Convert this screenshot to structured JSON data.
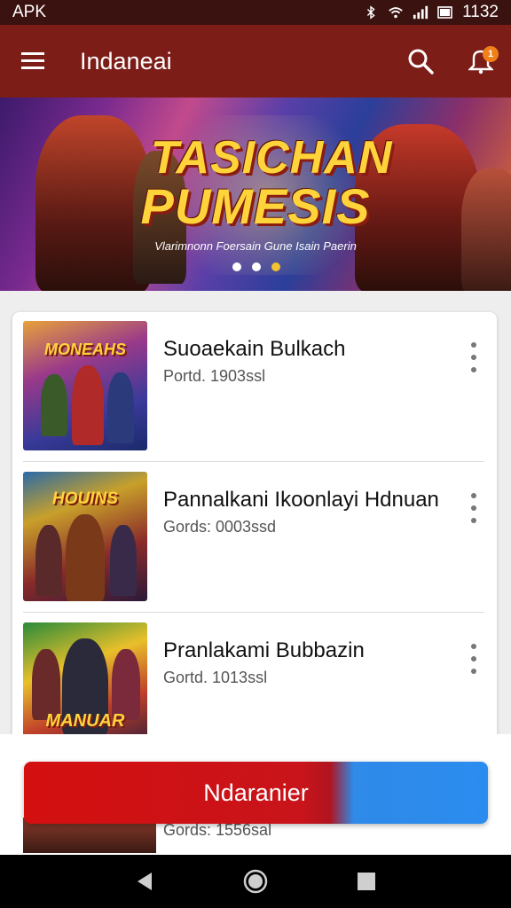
{
  "status_bar": {
    "left_text": "APK",
    "time": "1132",
    "icons": [
      "bluetooth-icon",
      "wifi-icon",
      "signal-icon",
      "battery-icon"
    ]
  },
  "app_bar": {
    "title": "Indaneai",
    "notification_count": "1",
    "icons": [
      "menu-icon",
      "search-icon",
      "notification-icon"
    ]
  },
  "banner": {
    "title_line1": "TASICHAN",
    "title_line2": "PUMESIS",
    "tagline": "Vlarimnonn Foersain Gune Isain Paerin",
    "page_count": 3,
    "active_index": 2
  },
  "list": {
    "items": [
      {
        "name": "Suoaekain Bulkach",
        "subtitle": "Portd. 1903ssl",
        "thumb_title": "MONEAHS"
      },
      {
        "name": "Pannalkani Ikoonlayi Hdnuan",
        "subtitle": "Gords: 0003ssd",
        "thumb_title": "HOUINS"
      },
      {
        "name": "Pranlakami Bubbazin",
        "subtitle": "Gortd. 1013ssl",
        "thumb_title": "MANUAR"
      }
    ]
  },
  "bottom_sheet": {
    "cta_label": "Ndaranier",
    "peek_subtitle": "Gords: 1556sal"
  },
  "nav_bar": {
    "icons": [
      "back-icon",
      "home-icon",
      "recents-icon"
    ]
  },
  "colors": {
    "app_bar": "#7d1d18",
    "status_bar": "#3a1210",
    "cta_red": "#d40f10",
    "cta_blue": "#2b8cf0",
    "accent_gold": "#ffd43b"
  }
}
